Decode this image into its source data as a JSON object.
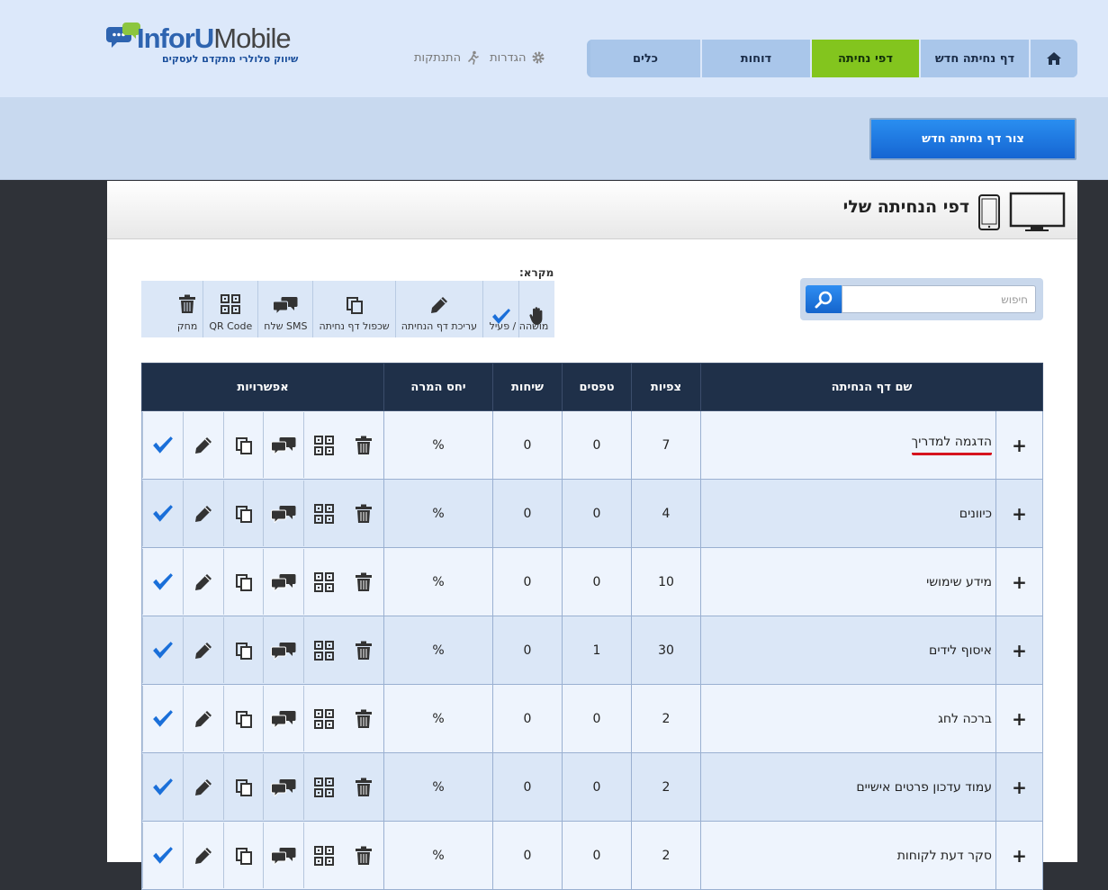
{
  "brand": {
    "name_part1": "InforU",
    "name_part2": "Mobile",
    "tagline": "שיווק סלולרי מתקדם לעסקים"
  },
  "top_links": {
    "settings": "הגדרות",
    "logout": "התנתקות"
  },
  "nav": {
    "items": [
      {
        "label": "דף נחיתה חדש"
      },
      {
        "label": "דפי נחיתה"
      },
      {
        "label": "דוחות"
      },
      {
        "label": "כלים"
      }
    ],
    "active_index": 1
  },
  "create_button": "צור דף נחיתה חדש",
  "panel": {
    "title": "דפי הנחיתה שלי"
  },
  "search": {
    "placeholder": "חיפוש"
  },
  "legend": {
    "title": "מקרא:",
    "items": [
      {
        "label": "מושהה / פעיל",
        "icon": "hand-icon"
      },
      {
        "label": "עריכת דף הנחיתה",
        "icon": "pencil-icon"
      },
      {
        "label": "שכפול דף נחיתה",
        "icon": "copy-icon"
      },
      {
        "label": "שלח SMS",
        "icon": "chat-icon"
      },
      {
        "label": "QR Code",
        "icon": "qr-icon"
      },
      {
        "label": "מחק",
        "icon": "trash-icon"
      }
    ]
  },
  "table": {
    "headers": {
      "name": "שם דף הנחיתה",
      "views": "צפיות",
      "forms": "טפסים",
      "calls": "שיחות",
      "conversion": "יחס המרה",
      "options": "אפשרויות"
    },
    "rows": [
      {
        "name": "הדגמה למדריך",
        "views": "7",
        "forms": "0",
        "calls": "0",
        "conversion": "%"
      },
      {
        "name": "כיוונים",
        "views": "4",
        "forms": "0",
        "calls": "0",
        "conversion": "%"
      },
      {
        "name": "מידע שימושי",
        "views": "10",
        "forms": "0",
        "calls": "0",
        "conversion": "%"
      },
      {
        "name": "איסוף לידים",
        "views": "30",
        "forms": "1",
        "calls": "0",
        "conversion": "%"
      },
      {
        "name": "ברכה לחג",
        "views": "2",
        "forms": "0",
        "calls": "0",
        "conversion": "%"
      },
      {
        "name": "עמוד עדכון פרטים אישיים",
        "views": "2",
        "forms": "0",
        "calls": "0",
        "conversion": "%"
      },
      {
        "name": "סקר דעת לקוחות",
        "views": "2",
        "forms": "0",
        "calls": "0",
        "conversion": "%"
      }
    ],
    "expand_symbol": "+"
  },
  "colors": {
    "accent_blue": "#1a6fd9",
    "active_nav": "#83c51e",
    "table_header": "#1f3049",
    "highlight_underline": "#d6141e"
  }
}
